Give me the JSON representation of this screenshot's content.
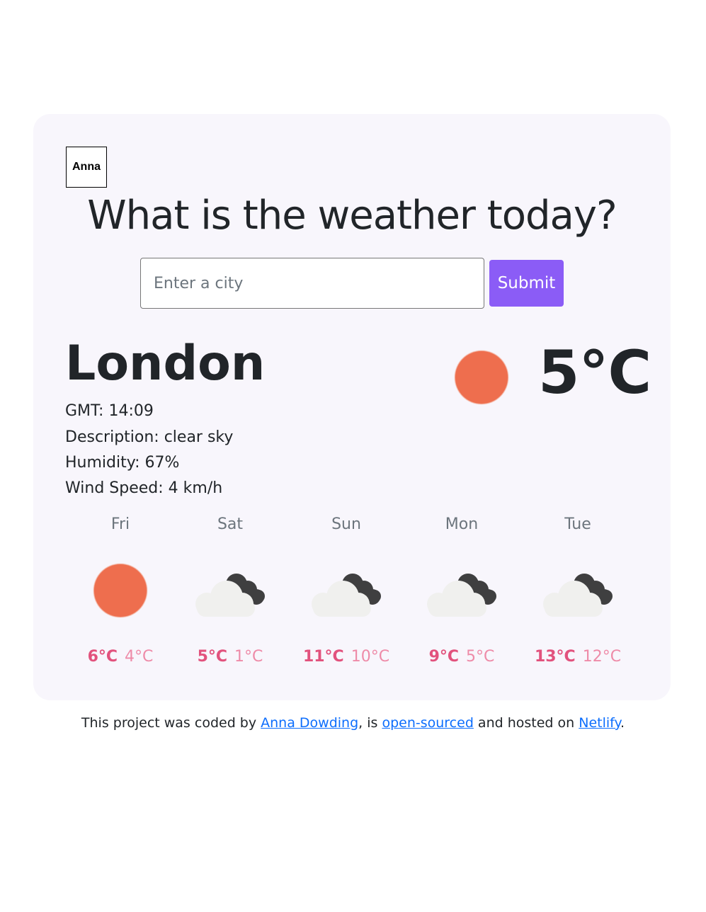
{
  "logo": {
    "text": "Anna"
  },
  "header": {
    "title": "What is the weather today?"
  },
  "search": {
    "placeholder": "Enter a city",
    "value": "",
    "submit_label": "Submit"
  },
  "current": {
    "city": "London",
    "temperature": "5°C",
    "icon": "sun-icon",
    "details": {
      "gmt": "GMT: 14:09",
      "description": "Description: clear sky",
      "humidity": "Humidity: 67%",
      "wind": "Wind Speed: 4 km/h"
    }
  },
  "forecast": [
    {
      "day": "Fri",
      "icon": "sun-icon",
      "max": "6°C",
      "min": "4°C"
    },
    {
      "day": "Sat",
      "icon": "cloudy-icon",
      "max": "5°C",
      "min": "1°C"
    },
    {
      "day": "Sun",
      "icon": "cloudy-icon",
      "max": "11°C",
      "min": "10°C"
    },
    {
      "day": "Mon",
      "icon": "cloudy-icon",
      "max": "9°C",
      "min": "5°C"
    },
    {
      "day": "Tue",
      "icon": "cloudy-icon",
      "max": "13°C",
      "min": "12°C"
    }
  ],
  "footer": {
    "prefix": "This project was coded by ",
    "author_link": "Anna Dowding",
    "middle1": ", is ",
    "source_link": "open-sourced",
    "middle2": " and hosted on ",
    "host_link": "Netlify",
    "suffix": "."
  },
  "colors": {
    "accent": "#8b5cf6",
    "card_background": "#f8f6fc",
    "sun": "#ee6e4e",
    "temp_max": "#e2527d",
    "temp_min": "#ee8ba8",
    "link": "#0d6efd"
  }
}
